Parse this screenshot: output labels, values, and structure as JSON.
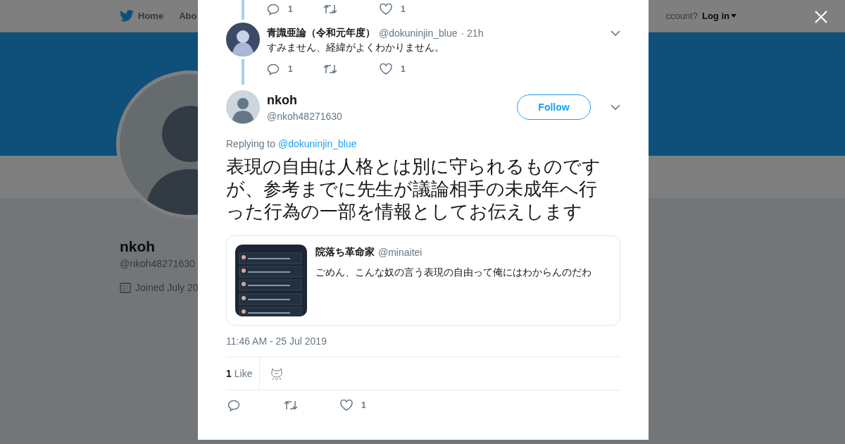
{
  "background_page": {
    "nav": {
      "home": "Home",
      "about_cut": "Abo",
      "account_cut": "ccount?",
      "login": "Log in"
    },
    "profile": {
      "name": "nkoh",
      "handle": "@nkoh48271630",
      "joined_cut": "Joined July 20"
    }
  },
  "modal": {
    "thread_above": {
      "actions": [
        {
          "kind": "reply",
          "count": "1"
        },
        {
          "kind": "retweet"
        },
        {
          "kind": "like",
          "count": "1"
        }
      ]
    },
    "reply": {
      "name": "青識亜論（令和元年度）",
      "handle": "@dokuninjin_blue",
      "time": "· 21h",
      "text": "すみません、経緯がよくわかりません。",
      "actions": [
        {
          "kind": "reply",
          "count": "1"
        },
        {
          "kind": "retweet"
        },
        {
          "kind": "like",
          "count": "1"
        }
      ]
    },
    "tweet": {
      "name": "nkoh",
      "handle": "@nkoh48271630",
      "follow": "Follow",
      "replying_label": "Replying to",
      "replying_to": "@dokuninjin_blue",
      "text": "表現の自由は人格とは別に守られるものですが、参考までに先生が議論相手の未成年へ行った行為の一部を情報としてお伝えします",
      "quote": {
        "name": "院落ち革命家",
        "handle": "@minaitei",
        "text": "ごめん、こんな奴の言う表現の自由って俺にはわからんのだわ"
      },
      "timestamp": "11:46 AM - 25 Jul 2019",
      "likes_count": "1",
      "likes_label": "Like",
      "actions": [
        {
          "kind": "reply"
        },
        {
          "kind": "retweet"
        },
        {
          "kind": "like",
          "count": "1"
        }
      ]
    }
  }
}
